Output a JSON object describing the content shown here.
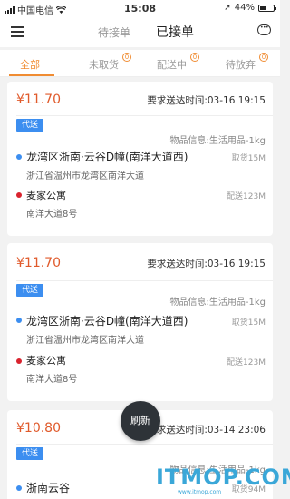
{
  "status_bar": {
    "carrier": "中国电信",
    "time": "15:08",
    "battery": "44%"
  },
  "nav": {
    "tab_pending": "待接单",
    "tab_accepted": "已接单"
  },
  "tabs": [
    {
      "label": "全部",
      "count": ""
    },
    {
      "label": "未取货",
      "count": "0"
    },
    {
      "label": "配送中",
      "count": "0"
    },
    {
      "label": "待放弃",
      "count": "0"
    }
  ],
  "orders": [
    {
      "price": "¥11.70",
      "required_time": "要求送达时间:03-16 19:15",
      "tag": "代送",
      "goods": "物品信息:生活用品-1kg",
      "pickup_name": "龙湾区浙南·云谷D幢(南洋大道西)",
      "pickup_dist": "取货15M",
      "pickup_addr": "浙江省温州市龙湾区南洋大道",
      "dest_name": "麦家公寓",
      "dest_dist": "配送123M",
      "dest_addr": "南洋大道8号"
    },
    {
      "price": "¥11.70",
      "required_time": "要求送达时间:03-16 19:15",
      "tag": "代送",
      "goods": "物品信息:生活用品-1kg",
      "pickup_name": "龙湾区浙南·云谷D幢(南洋大道西)",
      "pickup_dist": "取货15M",
      "pickup_addr": "浙江省温州市龙湾区南洋大道",
      "dest_name": "麦家公寓",
      "dest_dist": "配送123M",
      "dest_addr": "南洋大道8号"
    },
    {
      "price": "¥10.80",
      "required_time": "要求送达时间:03-14 23:06",
      "tag": "代送",
      "goods": "物品信息:生活用品-1kg",
      "pickup_name": "浙南云谷",
      "pickup_dist": "取货94M"
    }
  ],
  "refresh_label": "刷新",
  "watermark": {
    "main": "ITMOP.COM",
    "sub": "www.itmop.com"
  },
  "colors": {
    "accent": "#f08c32",
    "price": "#e05a2b",
    "tag": "#3c8ef0",
    "pickup_dot": "#3c8ef0",
    "dest_dot": "#d9232e"
  }
}
